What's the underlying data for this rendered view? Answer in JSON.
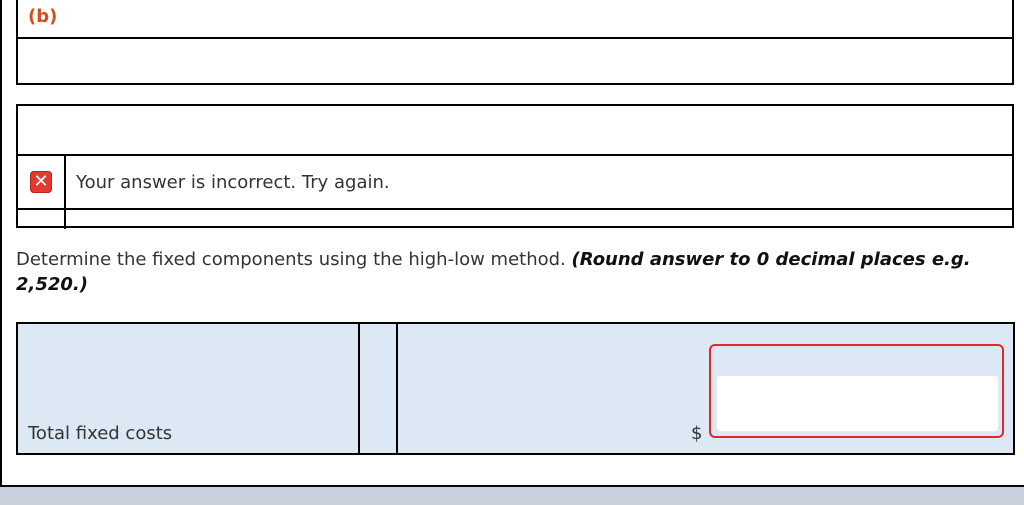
{
  "part": {
    "label": "(b)"
  },
  "feedback": {
    "icon": "error-x-icon",
    "message": "Your answer is incorrect.  Try again."
  },
  "instruction": {
    "text": "Determine the fixed components using the high-low method. ",
    "bold_text": "(Round answer to 0 decimal places e.g. 2,520.)"
  },
  "answer": {
    "row_label": "Total fixed costs",
    "currency": "$",
    "value": "",
    "error_color": "#e02a2a"
  }
}
